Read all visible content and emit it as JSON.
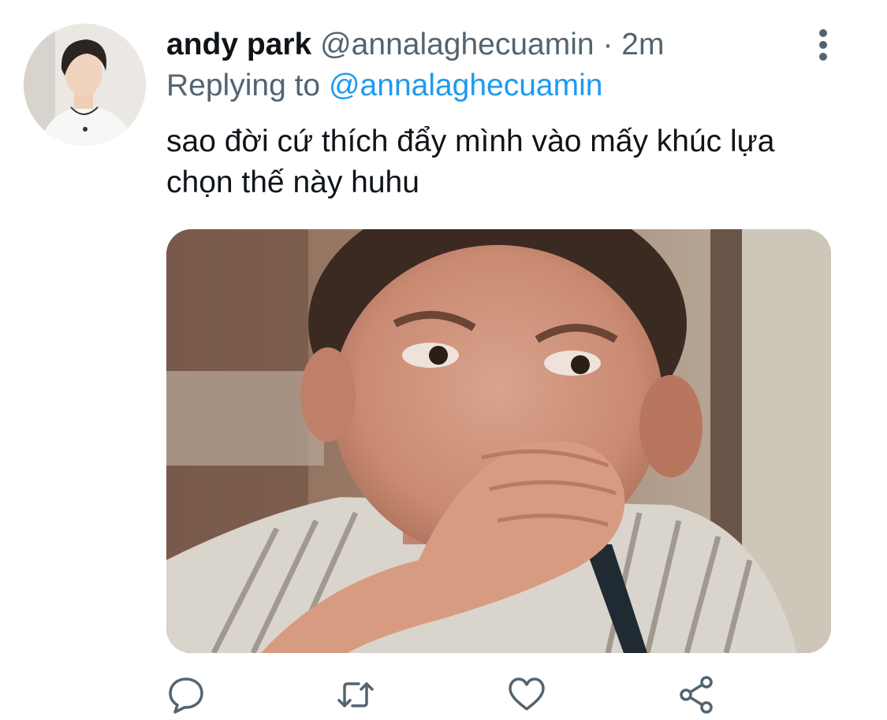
{
  "tweet": {
    "display_name": "andy park",
    "handle": "@annalaghecuamin",
    "separator": "·",
    "time": "2m",
    "reply_prefix": "Replying to",
    "reply_to": "@annalaghecuamin",
    "text": "sao đời cứ thích đẩy mình vào mấy khúc lựa chọn thế này huhu"
  },
  "icons": {
    "more": "more-vertical-icon",
    "reply": "reply-icon",
    "retweet": "retweet-icon",
    "like": "heart-icon",
    "share": "share-icon"
  },
  "colors": {
    "text": "#0f1419",
    "secondary": "#536471",
    "link": "#1d9bf0",
    "icon": "#536471"
  }
}
